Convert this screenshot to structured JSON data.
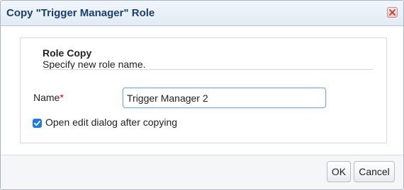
{
  "dialog": {
    "title": "Copy \"Trigger Manager\" Role",
    "close_icon": "close-icon"
  },
  "section": {
    "title": "Role Copy",
    "subtitle": "Specify new role name."
  },
  "form": {
    "name_label": "Name",
    "required_marker": "*",
    "name_value": "Trigger Manager 2",
    "open_edit_checked": true,
    "open_edit_label": "Open edit dialog after copying"
  },
  "buttons": {
    "ok": "OK",
    "cancel": "Cancel"
  },
  "colors": {
    "title_text": "#1b3f73",
    "required": "#d0021b",
    "checkbox": "#1f7be0",
    "close_icon": "#c0392b"
  }
}
